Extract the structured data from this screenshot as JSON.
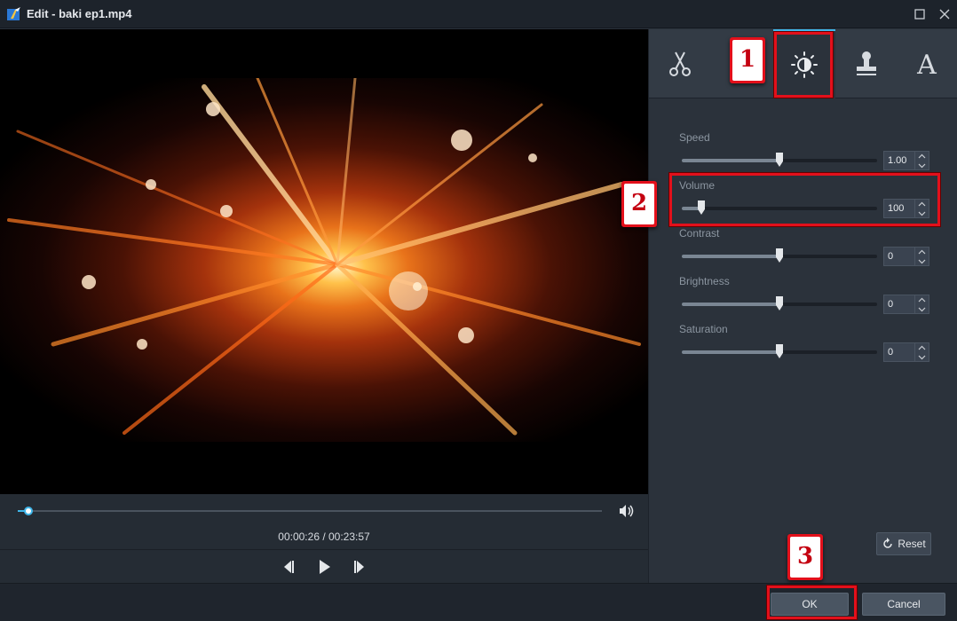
{
  "window": {
    "title": "Edit - baki ep1.mp4"
  },
  "player": {
    "progress": 0.018,
    "current_time": "00:00:26",
    "duration": "00:23:57",
    "time_display": "00:00:26 / 00:23:57"
  },
  "tabs": [
    {
      "name": "cut",
      "icon": "scissors-icon",
      "active": false
    },
    {
      "name": "effect",
      "icon": "brightness-contrast-icon",
      "active": true
    },
    {
      "name": "watermark",
      "icon": "stamp-icon",
      "active": false
    },
    {
      "name": "subtitle",
      "icon": "text-A-icon",
      "active": false
    }
  ],
  "adjustments": [
    {
      "label": "Speed",
      "value": "1.00",
      "level": 0.5
    },
    {
      "label": "Volume",
      "value": "100",
      "level": 0.1
    },
    {
      "label": "Contrast",
      "value": "0",
      "level": 0.5
    },
    {
      "label": "Brightness",
      "value": "0",
      "level": 0.5
    },
    {
      "label": "Saturation",
      "value": "0",
      "level": 0.5
    }
  ],
  "buttons": {
    "reset": "Reset",
    "ok": "OK",
    "cancel": "Cancel"
  },
  "annotations": {
    "marker1": "1",
    "marker2": "2",
    "marker3": "3",
    "marker_color": "#e3101b"
  },
  "colors": {
    "accent": "#3fb6ea",
    "panel_bg": "#2b323b",
    "titlebar_bg": "#1d232b"
  }
}
